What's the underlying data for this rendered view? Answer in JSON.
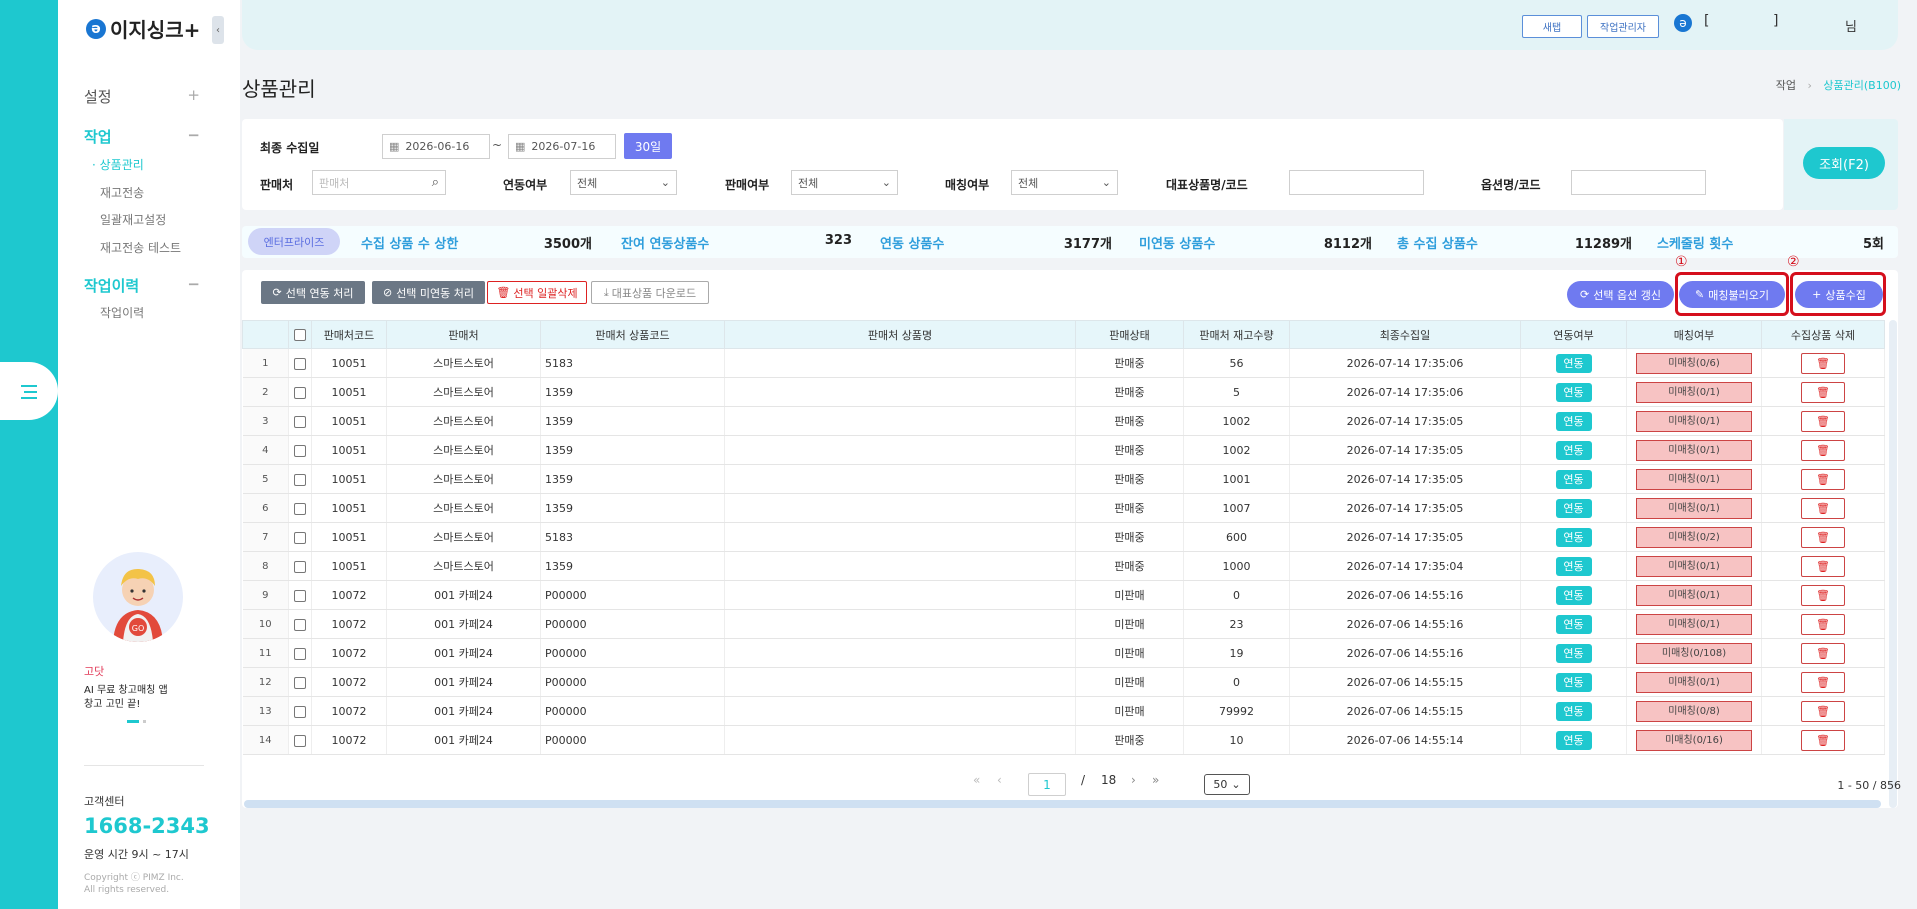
{
  "brand": {
    "logo_text": "이지싱크+",
    "accent": "#1ec8cf"
  },
  "sidebar": {
    "groups": [
      {
        "label": "설정",
        "toggle": "+"
      },
      {
        "label": "작업",
        "toggle": "−",
        "items": [
          "상품관리",
          "재고전송",
          "일괄재고설정",
          "재고전송 테스트"
        ]
      },
      {
        "label": "작업이력",
        "toggle": "−",
        "items": [
          "작업이력"
        ]
      }
    ],
    "promo": {
      "title": "고닷",
      "text": "AI 무료 창고매칭 앱\n창고 고민 끝!",
      "badge": "GO"
    },
    "customer_center": {
      "label": "고객센터",
      "phone": "1668-2343",
      "hours": "운영 시간 9시 ~ 17시",
      "copyright": "Copyright ⓒ PIMZ Inc.\nAll rights reserved."
    }
  },
  "topbar": {
    "new_tab": "새탭",
    "job_manager": "작업관리자",
    "user_bracket_open": "[",
    "user_bracket_close": "]",
    "honorific": "님"
  },
  "page": {
    "title": "상품관리",
    "breadcrumb": [
      "작업",
      "상품관리(B100)"
    ]
  },
  "filter": {
    "last_collected_label": "최종 수집일",
    "date_from": "2026-06-16",
    "tilde": "~",
    "date_to": "2026-07-16",
    "days_button": "30일",
    "seller_label": "판매처",
    "seller_placeholder": "판매처",
    "link_label": "연동여부",
    "link_value": "전체",
    "sale_label": "판매여부",
    "sale_value": "전체",
    "match_label": "매칭여부",
    "match_value": "전체",
    "rep_label": "대표상품명/코드",
    "option_label": "옵션명/코드",
    "search_button": "조회(F2)"
  },
  "stats": {
    "badge": "엔터프라이즈",
    "items": [
      {
        "label": "수집 상품 수 상한",
        "value": "3500개"
      },
      {
        "label": "잔여 연동상품수",
        "value": "323"
      },
      {
        "label": "연동 상품수",
        "value": "3177개"
      },
      {
        "label": "미연동 상품수",
        "value": "8112개"
      },
      {
        "label": "총 수집 상품수",
        "value": "11289개"
      },
      {
        "label": "스케줄링 횟수",
        "value": "5회"
      }
    ]
  },
  "toolbar": {
    "link_selected": "선택 연동 처리",
    "unlink_selected": "선택 미연동 처리",
    "bulk_delete": "선택 일괄삭제",
    "download": "대표상품 다운로드",
    "option_refresh": "선택 옵션 갱신",
    "load_matching": "매칭불러오기",
    "collect": "상품수집",
    "marker_1": "①",
    "marker_2": "②"
  },
  "table": {
    "columns": [
      "",
      "판매처코드",
      "판매처",
      "판매처 상품코드",
      "판매처 상품명",
      "판매상태",
      "판매처 재고수량",
      "최종수집일",
      "연동여부",
      "매칭여부",
      "수집상품 삭제"
    ],
    "rows": [
      {
        "n": "1",
        "code": "10051",
        "seller": "스마트스토어",
        "pcode": "5183",
        "status": "판매중",
        "stock": "56",
        "date": "2026-07-14 17:35:06",
        "link": "연동",
        "match": "미매칭(0/6)"
      },
      {
        "n": "2",
        "code": "10051",
        "seller": "스마트스토어",
        "pcode": "1359",
        "status": "판매중",
        "stock": "5",
        "date": "2026-07-14 17:35:06",
        "link": "연동",
        "match": "미매칭(0/1)"
      },
      {
        "n": "3",
        "code": "10051",
        "seller": "스마트스토어",
        "pcode": "1359",
        "status": "판매중",
        "stock": "1002",
        "date": "2026-07-14 17:35:05",
        "link": "연동",
        "match": "미매칭(0/1)"
      },
      {
        "n": "4",
        "code": "10051",
        "seller": "스마트스토어",
        "pcode": "1359",
        "status": "판매중",
        "stock": "1002",
        "date": "2026-07-14 17:35:05",
        "link": "연동",
        "match": "미매칭(0/1)"
      },
      {
        "n": "5",
        "code": "10051",
        "seller": "스마트스토어",
        "pcode": "1359",
        "status": "판매중",
        "stock": "1001",
        "date": "2026-07-14 17:35:05",
        "link": "연동",
        "match": "미매칭(0/1)"
      },
      {
        "n": "6",
        "code": "10051",
        "seller": "스마트스토어",
        "pcode": "1359",
        "status": "판매중",
        "stock": "1007",
        "date": "2026-07-14 17:35:05",
        "link": "연동",
        "match": "미매칭(0/1)"
      },
      {
        "n": "7",
        "code": "10051",
        "seller": "스마트스토어",
        "pcode": "5183",
        "status": "판매중",
        "stock": "600",
        "date": "2026-07-14 17:35:05",
        "link": "연동",
        "match": "미매칭(0/2)"
      },
      {
        "n": "8",
        "code": "10051",
        "seller": "스마트스토어",
        "pcode": "1359",
        "status": "판매중",
        "stock": "1000",
        "date": "2026-07-14 17:35:04",
        "link": "연동",
        "match": "미매칭(0/1)"
      },
      {
        "n": "9",
        "code": "10072",
        "seller": "001 카페24",
        "pcode": "P00000",
        "status": "미판매",
        "stock": "0",
        "date": "2026-07-06 14:55:16",
        "link": "연동",
        "match": "미매칭(0/1)"
      },
      {
        "n": "10",
        "code": "10072",
        "seller": "001 카페24",
        "pcode": "P00000",
        "status": "미판매",
        "stock": "23",
        "date": "2026-07-06 14:55:16",
        "link": "연동",
        "match": "미매칭(0/1)"
      },
      {
        "n": "11",
        "code": "10072",
        "seller": "001 카페24",
        "pcode": "P00000",
        "status": "미판매",
        "stock": "19",
        "date": "2026-07-06 14:55:16",
        "link": "연동",
        "match": "미매칭(0/108)"
      },
      {
        "n": "12",
        "code": "10072",
        "seller": "001 카페24",
        "pcode": "P00000",
        "status": "미판매",
        "stock": "0",
        "date": "2026-07-06 14:55:15",
        "link": "연동",
        "match": "미매칭(0/1)"
      },
      {
        "n": "13",
        "code": "10072",
        "seller": "001 카페24",
        "pcode": "P00000",
        "status": "미판매",
        "stock": "79992",
        "date": "2026-07-06 14:55:15",
        "link": "연동",
        "match": "미매칭(0/8)"
      },
      {
        "n": "14",
        "code": "10072",
        "seller": "001 카페24",
        "pcode": "P00000",
        "status": "판매중",
        "stock": "10",
        "date": "2026-07-06 14:55:14",
        "link": "연동",
        "match": "미매칭(0/16)"
      }
    ]
  },
  "pagination": {
    "current": "1",
    "slash": "/",
    "total_pages": "18",
    "page_size": "50",
    "range": "1 - 50 / 856"
  }
}
